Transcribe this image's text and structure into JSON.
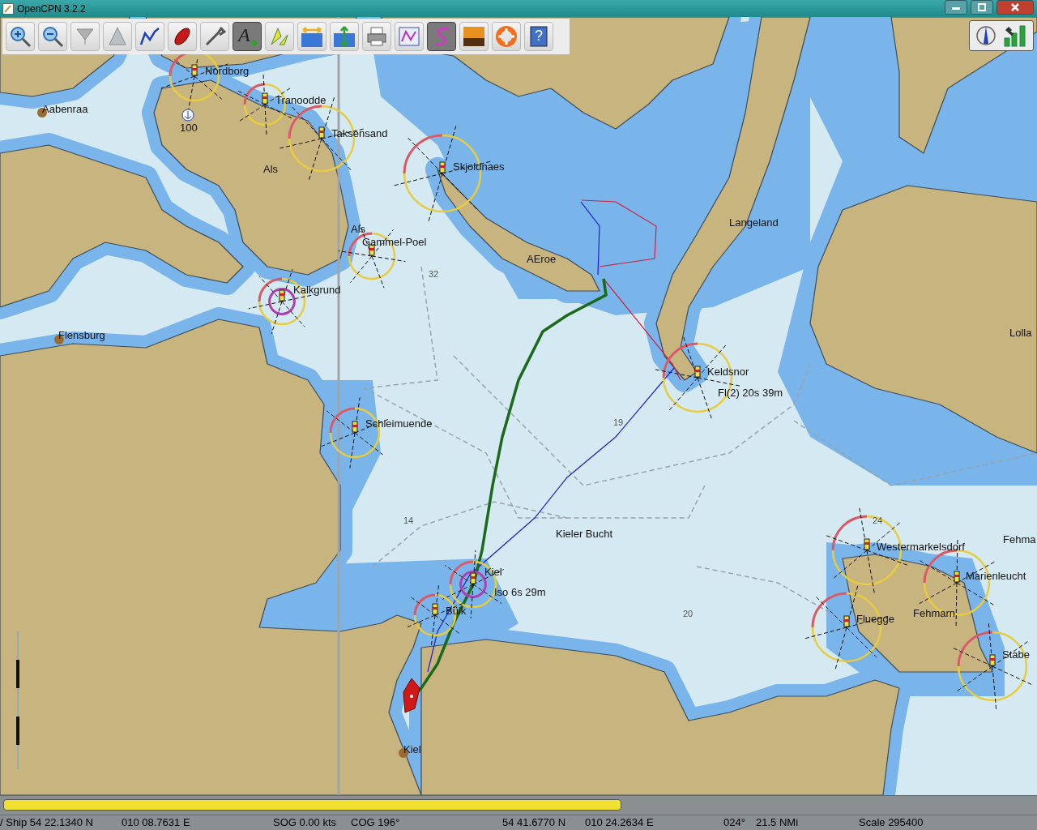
{
  "window": {
    "title": "OpenCPN 3.2.2"
  },
  "toolbar": {
    "tools": [
      {
        "kind": "zoom-in",
        "on": false
      },
      {
        "kind": "zoom-out",
        "on": false
      },
      {
        "kind": "scale-down",
        "on": false
      },
      {
        "kind": "scale-up",
        "on": false
      },
      {
        "kind": "route",
        "on": false
      },
      {
        "kind": "ship",
        "on": false
      },
      {
        "kind": "settings",
        "on": false
      },
      {
        "kind": "text",
        "on": true,
        "glyph": "A"
      },
      {
        "kind": "measure",
        "on": false
      },
      {
        "kind": "tide",
        "on": false
      },
      {
        "kind": "current",
        "on": false
      },
      {
        "kind": "print",
        "on": false
      },
      {
        "kind": "route-manager",
        "on": false
      },
      {
        "kind": "track",
        "on": true
      },
      {
        "kind": "color-scheme",
        "on": false
      },
      {
        "kind": "mob",
        "on": false
      },
      {
        "kind": "help",
        "on": false,
        "glyph": "?"
      }
    ]
  },
  "chart": {
    "labels": [
      {
        "text": "Nordborg",
        "kind": "place"
      },
      {
        "text": "Aabenraa",
        "kind": "place"
      },
      {
        "text": "100",
        "kind": "place"
      },
      {
        "text": "Tranoodde",
        "kind": "place"
      },
      {
        "text": "Taksensand",
        "kind": "place"
      },
      {
        "text": "Als",
        "kind": "place"
      },
      {
        "text": "Skjoldnaes",
        "kind": "place"
      },
      {
        "text": "Langeland",
        "kind": "place"
      },
      {
        "text": "Als",
        "kind": "place"
      },
      {
        "text": "Gammel-Poel",
        "kind": "place"
      },
      {
        "text": "32",
        "kind": "sounding"
      },
      {
        "text": "AEroe",
        "kind": "place"
      },
      {
        "text": "Kalkgrund",
        "kind": "place"
      },
      {
        "text": "Flensburg",
        "kind": "place"
      },
      {
        "text": "Lolla",
        "kind": "place"
      },
      {
        "text": "Keldsnor",
        "kind": "place"
      },
      {
        "text": "Fl(2) 20s 39m",
        "kind": "place"
      },
      {
        "text": "Schleimuende",
        "kind": "place"
      },
      {
        "text": "19",
        "kind": "sounding"
      },
      {
        "text": "14",
        "kind": "sounding"
      },
      {
        "text": "Kieler Bucht",
        "kind": "place"
      },
      {
        "text": "24",
        "kind": "sounding"
      },
      {
        "text": "Westermarkelsdorf",
        "kind": "place"
      },
      {
        "text": "Fehma",
        "kind": "place"
      },
      {
        "text": "Marienleucht",
        "kind": "place"
      },
      {
        "text": "Kiel",
        "kind": "place"
      },
      {
        "text": "Iso 6s 29m",
        "kind": "place"
      },
      {
        "text": "Bülk",
        "kind": "place"
      },
      {
        "text": "20",
        "kind": "sounding"
      },
      {
        "text": "Fehmarn",
        "kind": "place"
      },
      {
        "text": "Fluegge",
        "kind": "place"
      },
      {
        "text": "Stabe",
        "kind": "place"
      },
      {
        "text": "Kiel",
        "kind": "place"
      }
    ]
  },
  "progress": {
    "level": 0.6
  },
  "status_bar": {
    "fields": [
      "/ Ship 54 22.1340 N",
      "010 08.7631 E",
      "SOG 0.00 kts",
      "COG 196°",
      "54 41.6770 N",
      "010 24.2634 E",
      "024°",
      "21.5 NMi",
      "Scale 295400"
    ]
  }
}
